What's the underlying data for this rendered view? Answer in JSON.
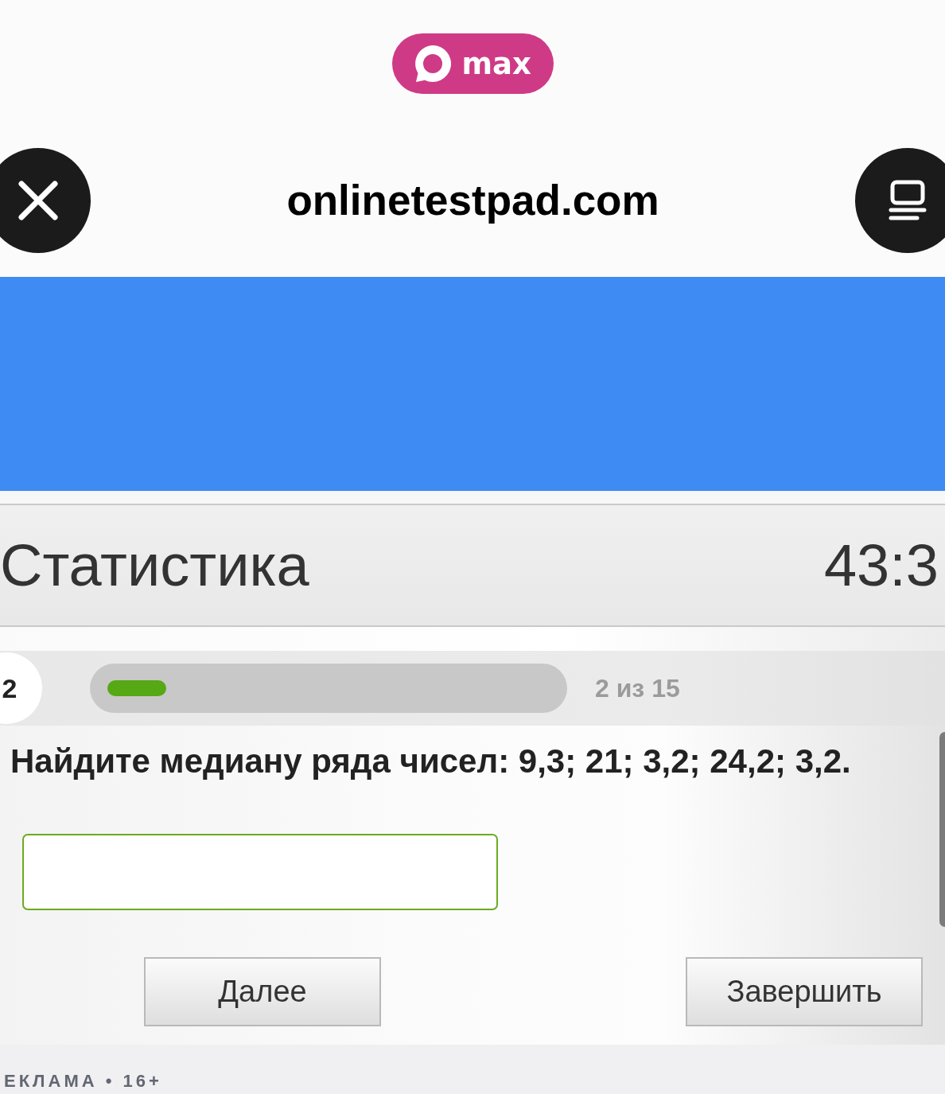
{
  "logo": {
    "text": "max"
  },
  "browser_bar": {
    "title": "onlinetestpad.com"
  },
  "test": {
    "title": "Статистика",
    "timer": "43:3"
  },
  "progress": {
    "question_number": "2",
    "level": 0.133,
    "counter": "2 из 15"
  },
  "question": {
    "text": "Найдите медиану ряда чисел: 9,3; 21; 3,2; 24,2; 3,2."
  },
  "buttons": [
    {
      "label": "Далее"
    },
    {
      "label": "Завершить"
    }
  ],
  "footer": {
    "ad_label": "ЕКЛАМА • 16+"
  }
}
